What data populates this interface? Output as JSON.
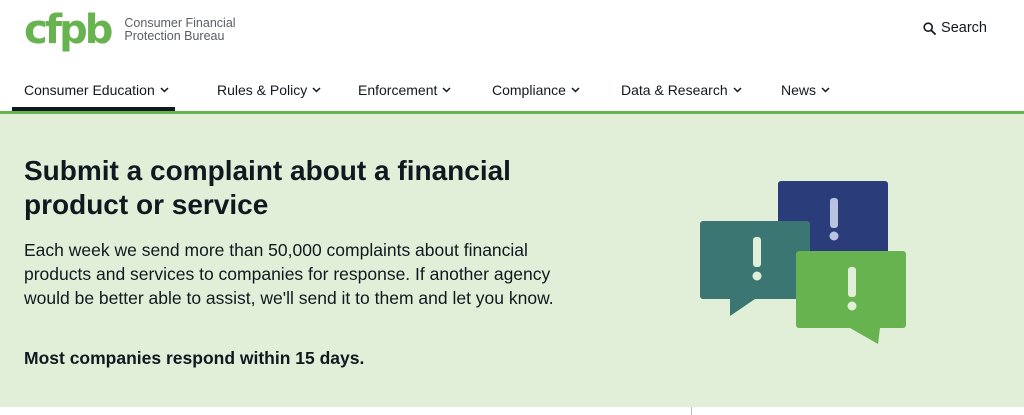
{
  "brand": {
    "logo_mark": "cfpb",
    "name_line1": "Consumer Financial",
    "name_line2": "Protection Bureau",
    "brand_color": "#66b34f"
  },
  "search": {
    "label": "Search",
    "icon": "search-icon"
  },
  "nav": {
    "items": [
      {
        "label": "Consumer Education",
        "active": true
      },
      {
        "label": "Rules & Policy"
      },
      {
        "label": "Enforcement"
      },
      {
        "label": "Compliance"
      },
      {
        "label": "Data & Research"
      },
      {
        "label": "News"
      }
    ]
  },
  "hero": {
    "title": "Submit a complaint about a financial product or service",
    "description": "Each week we send more than 50,000 complaints about financial products and services to companies for response. If another agency would be better able to assist, we'll send it to them and let you know.",
    "note": "Most companies respond within 15 days.",
    "background": "#e2efd8",
    "illustration_colors": {
      "navy": "#2a3d7a",
      "teal": "#3b7673",
      "green": "#66b34f"
    }
  }
}
